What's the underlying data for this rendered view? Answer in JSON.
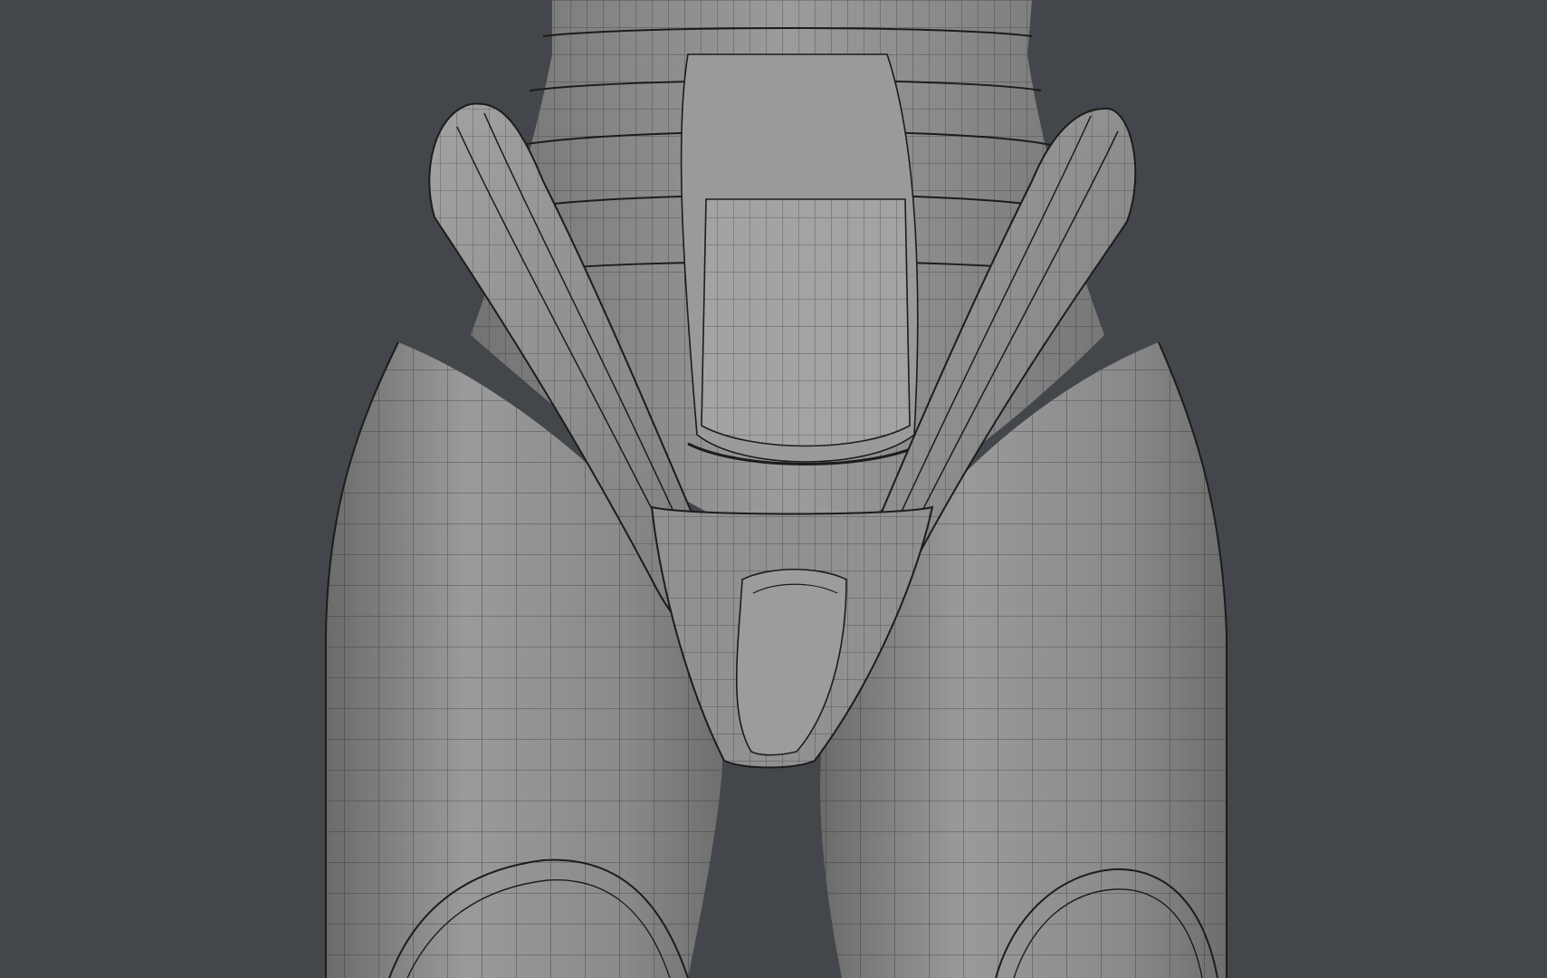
{
  "viewport": {
    "background": "#43474b",
    "mesh_fill": "#8d8d8d",
    "mesh_shade": "#6e6e6e",
    "mesh_highlight": "#a6a6a6",
    "wire_color": "#1c1c1c"
  }
}
